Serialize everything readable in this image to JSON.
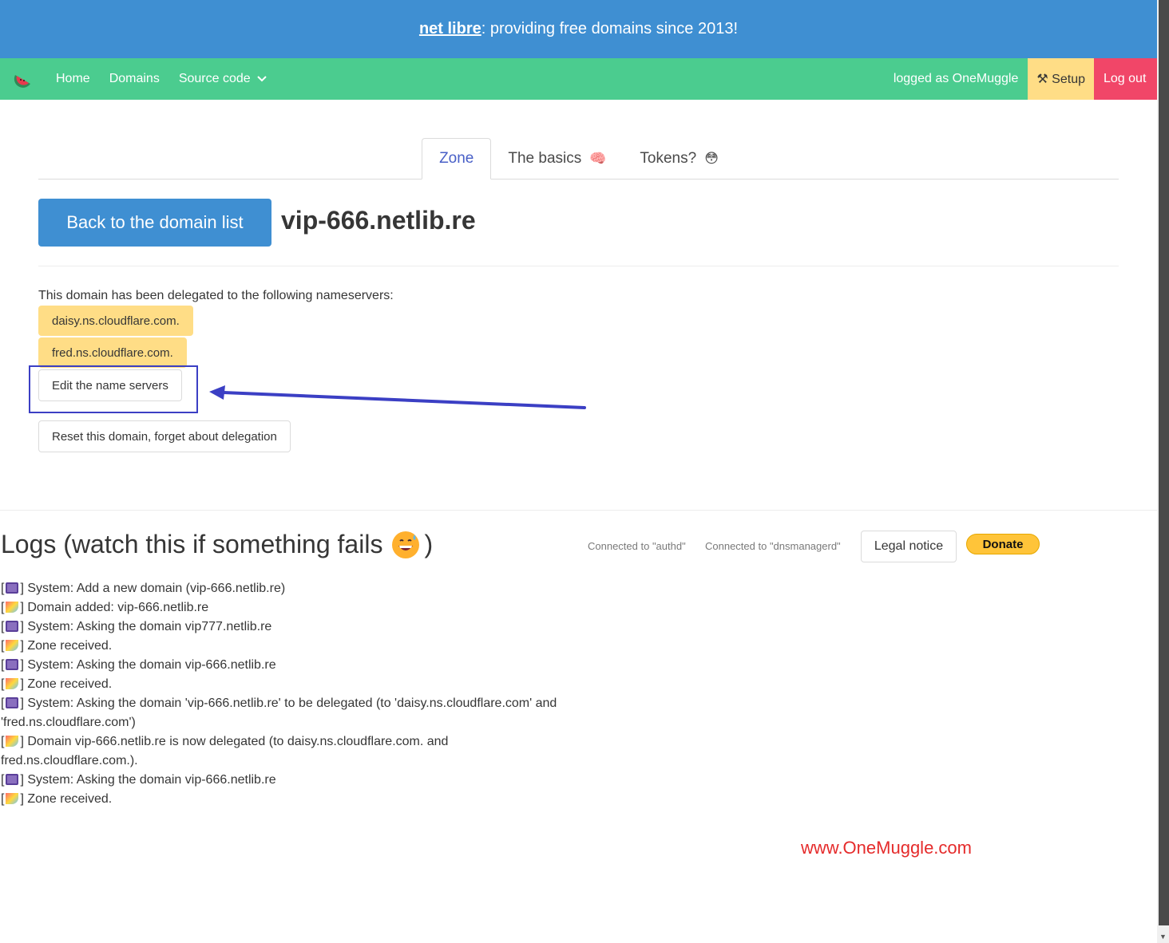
{
  "banner": {
    "brand": "net libre",
    "tagline": ": providing free domains since 2013!"
  },
  "navbar": {
    "logo_icon": "watermelon-icon",
    "items": [
      {
        "label": "Home"
      },
      {
        "label": "Domains"
      },
      {
        "label": "Source code"
      }
    ],
    "user_text": "logged as OneMuggle",
    "setup_label": "⚒ Setup",
    "logout_label": "Log out"
  },
  "tabs": [
    {
      "label": "Zone",
      "active": true
    },
    {
      "label": "The basics",
      "emoji": "🧠"
    },
    {
      "label": "Tokens?",
      "emoji": "😳"
    }
  ],
  "domain": {
    "back_label": "Back to the domain list",
    "name": "vip-666.netlib.re",
    "delegation_text": "This domain has been delegated to the following nameservers:",
    "nameservers": [
      "daisy.ns.cloudflare.com.",
      "fred.ns.cloudflare.com."
    ],
    "edit_label": "Edit the name servers",
    "reset_label": "Reset this domain, forget about delegation"
  },
  "logs": {
    "title_before": "Logs (watch this if something fails",
    "title_after": ")",
    "connections": [
      "Connected to \"authd\"",
      "Connected to \"dnsmanagerd\""
    ],
    "legal_label": "Legal notice",
    "donate_label": "Donate",
    "entries": [
      {
        "icon": "robot",
        "text": "System: Add a new domain (vip-666.netlib.re)"
      },
      {
        "icon": "party",
        "text": "Domain added: vip-666.netlib.re"
      },
      {
        "icon": "robot",
        "text": "System: Asking the domain vip777.netlib.re"
      },
      {
        "icon": "party",
        "text": "Zone received."
      },
      {
        "icon": "robot",
        "text": "System: Asking the domain vip-666.netlib.re"
      },
      {
        "icon": "party",
        "text": "Zone received."
      },
      {
        "icon": "robot",
        "text": "System: Asking the domain 'vip-666.netlib.re' to be delegated (to 'daisy.ns.cloudflare.com' and 'fred.ns.cloudflare.com')"
      },
      {
        "icon": "party",
        "text": "Domain vip-666.netlib.re is now delegated (to daisy.ns.cloudflare.com. and fred.ns.cloudflare.com.)."
      },
      {
        "icon": "robot",
        "text": "System: Asking the domain vip-666.netlib.re"
      },
      {
        "icon": "party",
        "text": "Zone received."
      }
    ]
  },
  "watermark": "www.OneMuggle.com",
  "colors": {
    "banner": "#3f8fd2",
    "navbar": "#4bcc8f",
    "setup": "#ffdd86",
    "logout": "#f14668",
    "annotation": "#3b3fc4"
  }
}
